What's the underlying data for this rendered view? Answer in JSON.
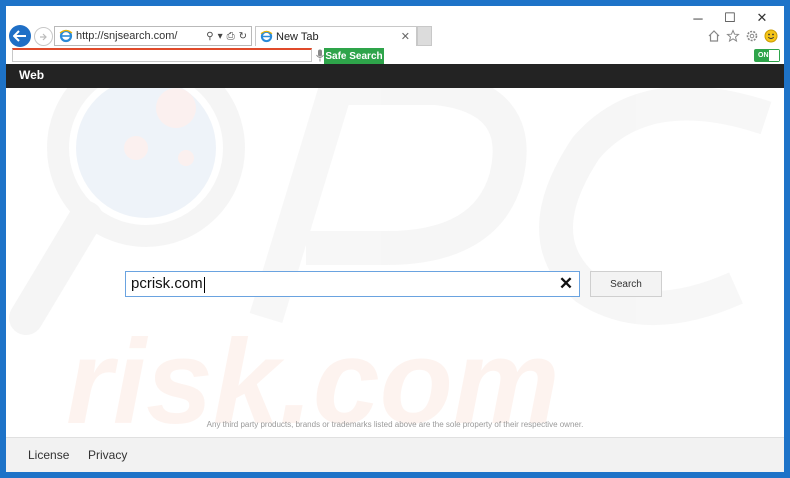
{
  "browser": {
    "url": "http://snjsearch.com/",
    "tab_label": "New Tab",
    "tab_close": "✕",
    "minimize": "─",
    "maximize": "☐",
    "close": "✕"
  },
  "toolbar": {
    "safe_search_label": "Safe Search",
    "toggle_label": "ON"
  },
  "nav": {
    "web_label": "Web"
  },
  "search": {
    "value": "pcrisk.com",
    "clear_symbol": "✕",
    "button_label": "Search"
  },
  "disclaimer": "Any third party products, brands or trademarks listed above are the sole property of their respective owner.",
  "footer": {
    "license": "License",
    "privacy": "Privacy"
  },
  "colors": {
    "frame": "#1e73c8",
    "accent_green": "#2ea44a",
    "nav_dark": "#232323"
  }
}
